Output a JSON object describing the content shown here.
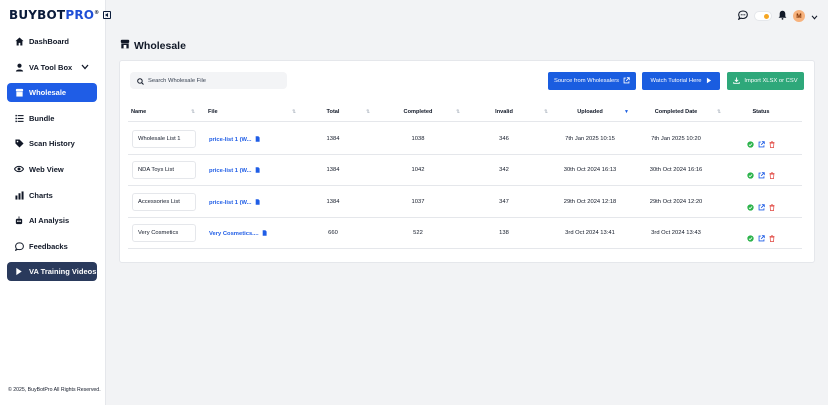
{
  "brand": {
    "name_main": "BUYBOT",
    "name_accent": "PRO",
    "reg": "®"
  },
  "sidebar": {
    "items": [
      {
        "label": "DashBoard",
        "icon": "home-icon"
      },
      {
        "label": "VA Tool Box",
        "icon": "user-icon"
      },
      {
        "label": "Wholesale",
        "icon": "store-icon"
      },
      {
        "label": "Bundle",
        "icon": "list-icon"
      },
      {
        "label": "Scan History",
        "icon": "tag-icon"
      },
      {
        "label": "Web View",
        "icon": "eye-icon"
      },
      {
        "label": "Charts",
        "icon": "chart-icon"
      },
      {
        "label": "AI Analysis",
        "icon": "robot-icon"
      },
      {
        "label": "Feedbacks",
        "icon": "chat-icon"
      },
      {
        "label": "VA Training Videos",
        "icon": "play-icon"
      }
    ],
    "copyright": "© 2025, BuyBotPro All Rights Reserved."
  },
  "topbar": {
    "avatar_initial": "M"
  },
  "page": {
    "title": "Wholesale"
  },
  "search": {
    "placeholder": "Search Wholesale File"
  },
  "buttons": {
    "source": "Source from Wholesalers",
    "tutorial": "Watch Tutorial Here",
    "import": "Import XLSX or CSV"
  },
  "table": {
    "headers": {
      "name": "Name",
      "file": "File",
      "total": "Total",
      "completed": "Completed",
      "invalid": "Invalid",
      "uploaded": "Uploaded",
      "completed_date": "Completed Date",
      "status": "Status"
    },
    "rows": [
      {
        "name": "Wholesale List 1",
        "file": "price-list 1 (W...",
        "total": "1384",
        "completed": "1038",
        "invalid": "346",
        "uploaded": "7th Jan 2025 10:15",
        "completed_date": "7th Jan 2025 10:20"
      },
      {
        "name": "NDA Toys List",
        "file": "price-list 1 (W...",
        "total": "1384",
        "completed": "1042",
        "invalid": "342",
        "uploaded": "30th Oct 2024 16:13",
        "completed_date": "30th Oct 2024 16:16"
      },
      {
        "name": "Accessories List",
        "file": "price-list 1 (W...",
        "total": "1384",
        "completed": "1037",
        "invalid": "347",
        "uploaded": "29th Oct 2024 12:18",
        "completed_date": "29th Oct 2024 12:20"
      },
      {
        "name": "Very Cosmetics",
        "file": "Very Cosmetics....",
        "total": "660",
        "completed": "522",
        "invalid": "138",
        "uploaded": "3rd Oct 2024 13:41",
        "completed_date": "3rd Oct 2024 13:43"
      }
    ]
  },
  "colors": {
    "primary": "#1a5de0",
    "green": "#2ea87a",
    "danger": "#e0443e",
    "success": "#2bb34a"
  }
}
